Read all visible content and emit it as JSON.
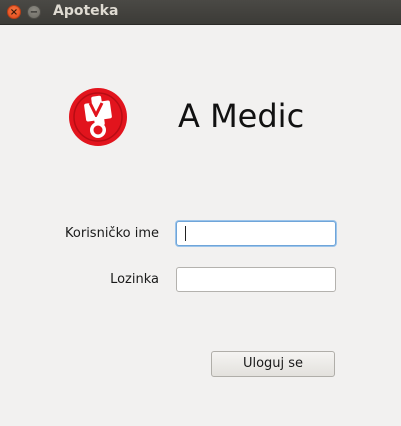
{
  "window": {
    "title": "Apoteka",
    "close_icon": "close-icon",
    "minimize_icon": "minimize-icon"
  },
  "header": {
    "logo_icon": "pharmacy-logo-icon",
    "app_name": "A Medic"
  },
  "form": {
    "username_label": "Korisničko ime",
    "username_value": "",
    "password_label": "Lozinka",
    "password_value": ""
  },
  "actions": {
    "login_label": "Uloguj se"
  },
  "colors": {
    "logo_red": "#e2141d",
    "focus_border": "#6fa5d9"
  }
}
